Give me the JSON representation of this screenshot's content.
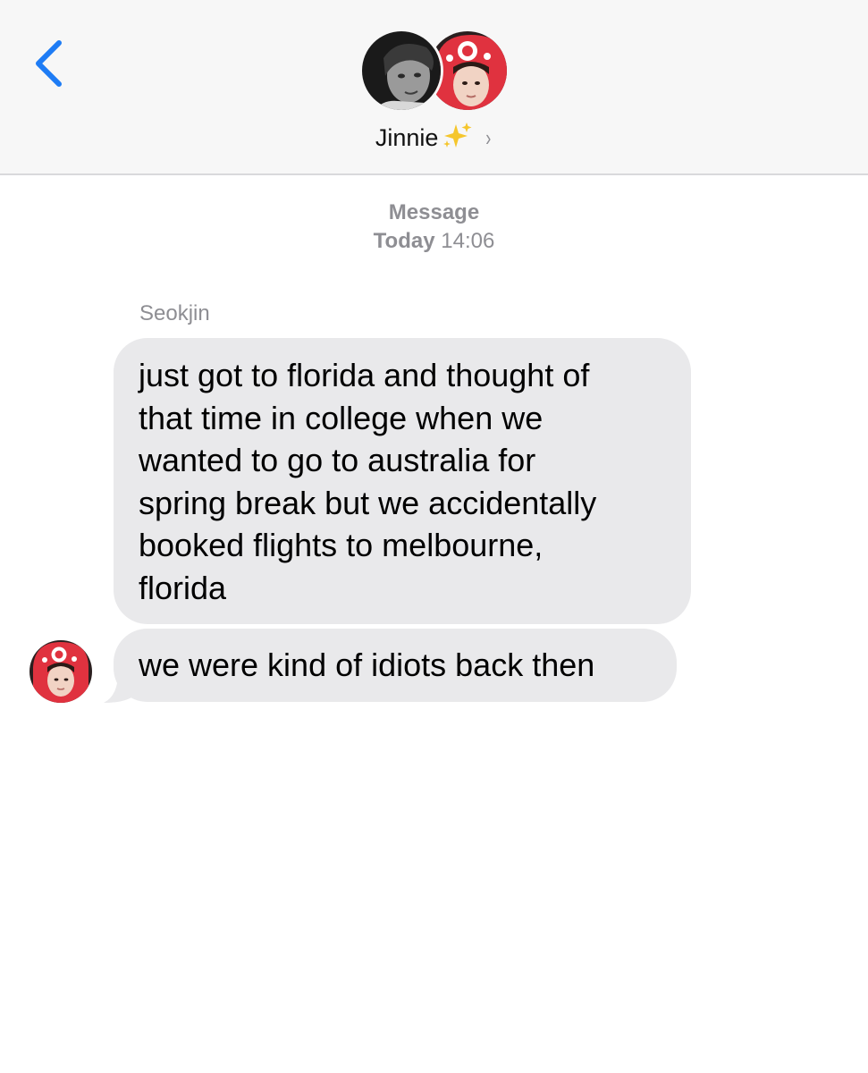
{
  "header": {
    "contact_name": "Jinnie",
    "sparkle_icon": "sparkles-emoji-icon",
    "chevron": "›"
  },
  "meta": {
    "label": "Message",
    "day": "Today",
    "time": "14:06"
  },
  "thread": {
    "sender_name": "Seokjin",
    "messages": [
      {
        "lines": [
          "just got to florida and thought of",
          "that time in college when we",
          "wanted to go to australia for",
          "spring break but we accidentally",
          "booked flights to melbourne,",
          "florida"
        ]
      },
      {
        "text": "we were kind of idiots back then"
      }
    ]
  },
  "colors": {
    "accent": "#1e7cf5",
    "bubble_received": "#e9e9eb",
    "secondary_text": "#8e8e93",
    "header_bg": "#f7f7f7"
  }
}
